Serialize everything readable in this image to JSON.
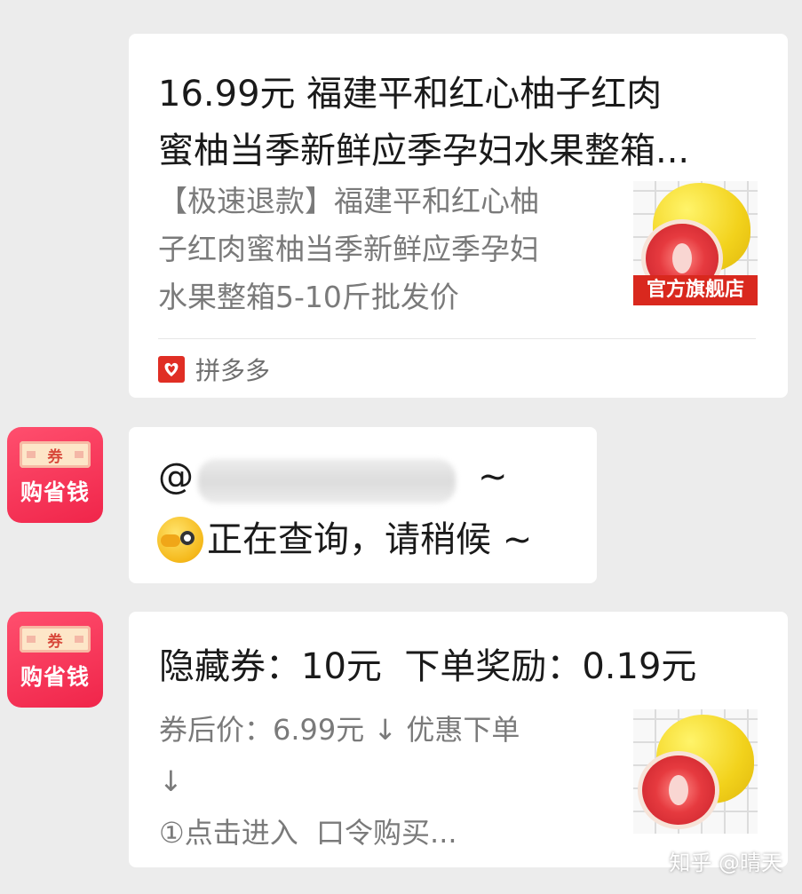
{
  "share_card": {
    "title": "16.99元 福建平和红心柚子红肉蜜柚当季新鲜应季孕妇水果整箱...",
    "title_line1": "16.99元 福建平和红心柚子红肉",
    "title_line2": "蜜柚当季新鲜应季孕妇水果整箱...",
    "desc_line1": "【极速退款】福建平和红心柚",
    "desc_line2": "子红肉蜜柚当季新鲜应季孕妇",
    "desc_line3": "水果整箱5-10斤批发价",
    "image_tag": "官方旗舰店",
    "source_app": "拼多多",
    "source_icon": "pinduoduo-logo-icon"
  },
  "bot": {
    "avatar_badge": "券",
    "avatar_name": "购省钱"
  },
  "message_1": {
    "mention_prefix": "@",
    "mention_suffix": "~",
    "status_text": "正在查询，请稍候 ~",
    "emoji": "peeking-face-icon"
  },
  "message_2": {
    "headline": "隐藏券：10元  下单奖励：0.19元",
    "price_line": "券后价：6.99元 ↓ 优惠下单",
    "arrow_line": "↓",
    "step_line": "①点击进入  口令购买..."
  },
  "watermark": "知乎 @晴天",
  "colors": {
    "background": "#ececec",
    "card": "#ffffff",
    "avatar_red": "#f0254a",
    "tag_red": "#d9281e",
    "secondary_text": "#7a7a7a"
  }
}
